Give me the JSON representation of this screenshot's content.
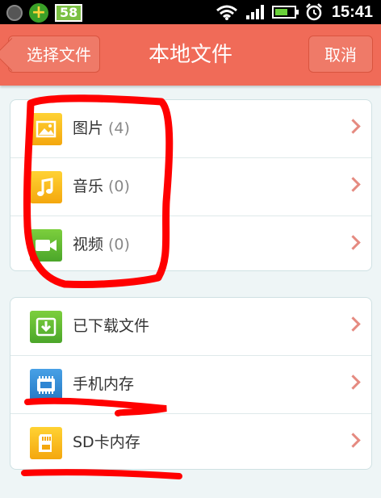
{
  "status_bar": {
    "badge": "58",
    "time": "15:41",
    "icons": [
      "notification-dot-icon",
      "plus-icon",
      "wifi-icon",
      "signal-icon",
      "battery-icon",
      "alarm-icon"
    ]
  },
  "header": {
    "back_label": "选择文件",
    "title": "本地文件",
    "cancel_label": "取消"
  },
  "media_group": [
    {
      "label": "图片",
      "count": "(4)",
      "icon": "image-icon"
    },
    {
      "label": "音乐",
      "count": "(0)",
      "icon": "music-icon"
    },
    {
      "label": "视频",
      "count": "(0)",
      "icon": "video-icon"
    }
  ],
  "storage_group": [
    {
      "label": "已下载文件",
      "icon": "download-box-icon"
    },
    {
      "label": "手机内存",
      "icon": "memory-chip-icon"
    },
    {
      "label": "SD卡内存",
      "icon": "sd-card-icon"
    }
  ],
  "colors": {
    "header": "#f06b58",
    "background": "#eef5f6",
    "annotation": "#ff0000"
  }
}
